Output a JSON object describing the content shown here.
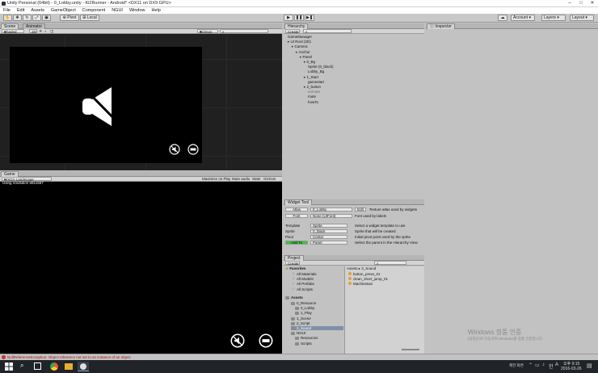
{
  "title_bar": {
    "title": "Unity Personal (64bit) - 0_Lobby.unity - Ki2Runner - Android* <DX11 on DX9 GPU>"
  },
  "menu": [
    "File",
    "Edit",
    "Assets",
    "GameObject",
    "Component",
    "NGUI",
    "Window",
    "Help"
  ],
  "toolbar": {
    "pivot_label": "Pivot",
    "local_label": "Local",
    "account_label": "Account",
    "layers_label": "Layers",
    "layout_label": "Layout"
  },
  "scene_panel": {
    "tab_scene": "Scene",
    "tab_animator": "Animator",
    "shading": "Shaded",
    "mode_2d": "2D",
    "gizmos": "Gizmos"
  },
  "game_panel": {
    "tab_game": "Game",
    "aspect": "WXGA Landscape (1280x800)",
    "resolution_text": "Using resolution 691x557",
    "maximize_on_play": "Maximize on Play",
    "mute_audio": "Mute audio",
    "stats": "Stats",
    "gizmos": "Gizmos"
  },
  "hierarchy": {
    "tab": "Hierarchy",
    "create": "Create",
    "items": [
      {
        "label": "GameManager",
        "depth": 0,
        "arrow": ""
      },
      {
        "label": "UI Root (2D)",
        "depth": 0,
        "arrow": "▼"
      },
      {
        "label": "Camera",
        "depth": 1,
        "arrow": "▼"
      },
      {
        "label": "Anchor",
        "depth": 2,
        "arrow": "▼"
      },
      {
        "label": "Panel",
        "depth": 3,
        "arrow": "▼"
      },
      {
        "label": "0_Bg",
        "depth": 4,
        "arrow": "▼"
      },
      {
        "label": "Sprite (0_black)",
        "depth": 5,
        "arrow": ""
      },
      {
        "label": "Lobby_Bg",
        "depth": 5,
        "arrow": ""
      },
      {
        "label": "1_Start",
        "depth": 4,
        "arrow": "▼"
      },
      {
        "label": "gamestart",
        "depth": 5,
        "arrow": ""
      },
      {
        "label": "2_button",
        "depth": 4,
        "arrow": "▼"
      },
      {
        "label": "unmute",
        "depth": 5,
        "arrow": "",
        "muted": true
      },
      {
        "label": "mute",
        "depth": 5,
        "arrow": ""
      },
      {
        "label": "howTo",
        "depth": 5,
        "arrow": ""
      }
    ]
  },
  "widget_tool": {
    "tab": "Widget Tool",
    "atlas_btn": "Atlas",
    "atlas_value": "0_Lobby",
    "edit_btn": "Edit",
    "atlas_desc": "Texture atlas used by widgets",
    "font_btn": "Font",
    "font_value": "None (UIFont)",
    "font_desc": "Font used by labels",
    "template_lbl": "Template",
    "template_val": "Sprite",
    "template_desc": "Select a widget template to use",
    "sprite_lbl": "Sprite",
    "sprite_val": "0_black",
    "sprite_desc": "Sprite that will be created",
    "pivot_lbl": "Pivot",
    "pivot_val": "Center",
    "pivot_desc": "Initial pivot point used by the sprite",
    "add_btn": "Add To",
    "add_val": "Panel",
    "add_desc": "Select the parent in the Hierarchy View"
  },
  "project": {
    "tab": "Project",
    "create": "Create",
    "favorites": "Favorites",
    "fav_items": [
      "All Materials",
      "All Models",
      "All Prefabs",
      "All Scripts"
    ],
    "assets": "Assets",
    "asset_tree": [
      {
        "label": "0_Resource",
        "depth": 1
      },
      {
        "label": "0_Lobby",
        "depth": 2
      },
      {
        "label": "1_Play",
        "depth": 2
      },
      {
        "label": "1_Scene",
        "depth": 1
      },
      {
        "label": "2_Script",
        "depth": 1
      },
      {
        "label": "3_Sound",
        "depth": 1,
        "selected": true
      },
      {
        "label": "NGUI",
        "depth": 1
      },
      {
        "label": "Resources",
        "depth": 2
      },
      {
        "label": "Scripts",
        "depth": 2
      }
    ],
    "breadcrumb": "Assets ▸ 3_Sound",
    "files": [
      "button_press_01",
      "clean_short_jump_01",
      "Machinetaxi"
    ]
  },
  "inspector": {
    "tab": "Inspector"
  },
  "status": {
    "message": "NullReferenceException: Object reference not set to an instance of an object"
  },
  "watermark": {
    "line1": "Windows 정품 인증",
    "line2": "[설정]으로 이동하여 Windows를 정품 인증합니다."
  },
  "taskbar": {
    "lang": "한",
    "ime": "A",
    "time": "오후 9:15",
    "date": "2016-03-26",
    "tray_text": "제한 화면"
  },
  "colors": {
    "panel": "#c2c2c2",
    "scene_bg": "#1e1e1e",
    "game_bg": "#0c0c0c",
    "add_btn": "#3ac43a",
    "error": "#d03030"
  }
}
